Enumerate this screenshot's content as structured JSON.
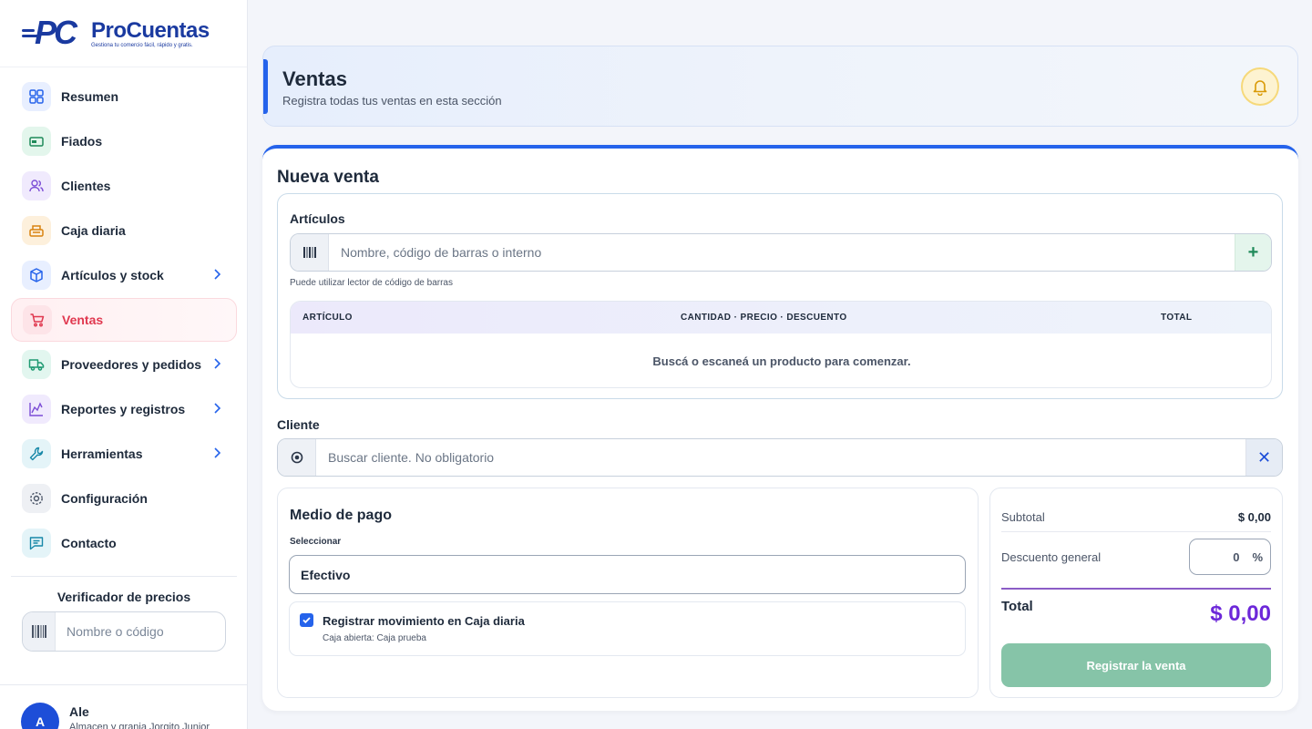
{
  "app": {
    "logo_initials": "PC",
    "logo_name": "ProCuentas",
    "logo_tagline": "Gestiona tu comercio fácil, rápido y gratis."
  },
  "sidebar": {
    "items": [
      {
        "label": "Resumen",
        "icon": "grid-icon"
      },
      {
        "label": "Fiados",
        "icon": "cash-icon"
      },
      {
        "label": "Clientes",
        "icon": "users-icon"
      },
      {
        "label": "Caja diaria",
        "icon": "register-icon"
      },
      {
        "label": "Artículos y stock",
        "icon": "box-icon"
      },
      {
        "label": "Ventas",
        "icon": "cart-icon",
        "active": true
      },
      {
        "label": "Proveedores y pedidos",
        "icon": "truck-icon"
      },
      {
        "label": "Reportes y registros",
        "icon": "chart-icon"
      },
      {
        "label": "Herramientas",
        "icon": "wrench-icon"
      },
      {
        "label": "Configuración",
        "icon": "gear-icon"
      },
      {
        "label": "Contacto",
        "icon": "message-icon"
      }
    ],
    "price_checker": {
      "title": "Verificador de precios",
      "placeholder": "Nombre o código"
    },
    "user": {
      "initial": "A",
      "name": "Ale",
      "store": "Almacen y granja Jorgito Junior"
    }
  },
  "header": {
    "title": "Ventas",
    "subtitle": "Registra todas tus ventas en esta sección"
  },
  "sale": {
    "title": "Nueva venta",
    "articles": {
      "title": "Artículos",
      "placeholder": "Nombre, código de barras o interno",
      "add_label": "+",
      "hint": "Puede utilizar lector de código de barras",
      "columns": [
        "ARTÍCULO",
        "CANTIDAD · PRECIO · DESCUENTO",
        "TOTAL"
      ],
      "empty": "Buscá o escaneá un producto para comenzar."
    },
    "client": {
      "title": "Cliente",
      "placeholder": "Buscar cliente. No obligatorio",
      "clear_label": "✕"
    },
    "payment": {
      "title": "Medio de pago",
      "select_label": "Seleccionar",
      "selected": "Efectivo",
      "register_label": "Registrar movimiento en Caja diaria",
      "register_checked": true,
      "register_sub": "Caja abierta: Caja prueba"
    },
    "summary": {
      "subtotal_label": "Subtotal",
      "subtotal_value": "$ 0,00",
      "discount_label": "Descuento general",
      "discount_value": "0",
      "discount_unit": "%",
      "total_label": "Total",
      "total_value": "$ 0,00",
      "submit_label": "Registrar la venta"
    }
  },
  "colors": {
    "primary": "#2563eb",
    "active_nav": "#e0384f",
    "total": "#6d28d9",
    "submit": "#86c4a8"
  }
}
